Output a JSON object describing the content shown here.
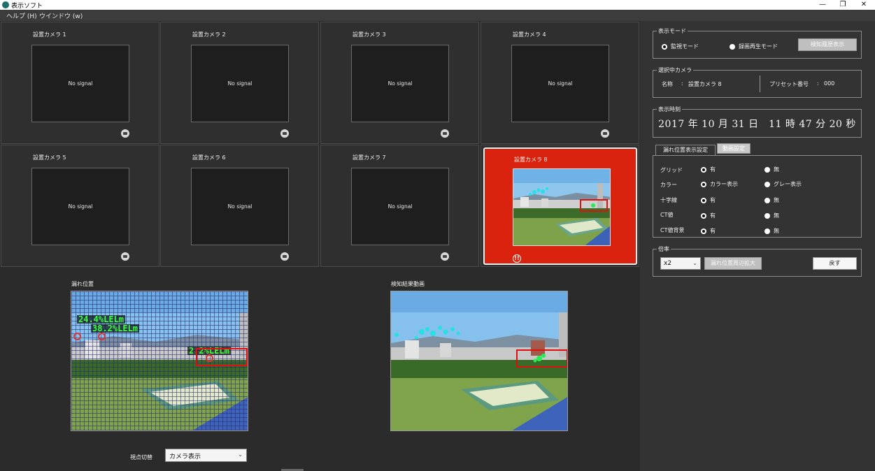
{
  "window": {
    "title": "表示ソフト",
    "controls": {
      "minimize": "—",
      "maximize": "❐",
      "close": "✕"
    }
  },
  "menu": {
    "items": [
      "ヘルプ (H)",
      "ウインドウ (w)"
    ]
  },
  "cameras": [
    {
      "label": "設置カメラ 1",
      "status": "No signal"
    },
    {
      "label": "設置カメラ 2",
      "status": "No signal"
    },
    {
      "label": "設置カメラ 3",
      "status": "No signal"
    },
    {
      "label": "設置カメラ 4",
      "status": "No signal"
    },
    {
      "label": "設置カメラ 5",
      "status": "No signal"
    },
    {
      "label": "設置カメラ 6",
      "status": "No signal"
    },
    {
      "label": "設置カメラ 7",
      "status": "No signal"
    },
    {
      "label": "設置カメラ 8",
      "status": "",
      "alert": true,
      "alert_symbol": "!!"
    }
  ],
  "leak_view": {
    "title": "漏れ位置",
    "readings": [
      "24.4%LELm",
      "38.2%LELm",
      "2.2%LELm"
    ]
  },
  "result_view": {
    "title": "検知結果動画"
  },
  "view_switch": {
    "label": "視点切替",
    "value": "カメラ表示",
    "chevron": "⌄"
  },
  "display_mode": {
    "title": "表示モード",
    "options": [
      {
        "label": "監視モード",
        "selected": true
      },
      {
        "label": "録画再生モード",
        "selected": false
      }
    ],
    "history_button": "検知履歴表示"
  },
  "selected_camera": {
    "title": "選択中カメラ",
    "name_label": "名称",
    "separator": ":",
    "name_value": "設置カメラ 8",
    "preset_label": "プリセット番号",
    "preset_value": "000"
  },
  "display_time": {
    "title": "表示時刻",
    "value": "2017 年 10 月 31 日　11 時 47 分 20 秒"
  },
  "settings_tabs": [
    "漏れ位置表示設定",
    "動画設定"
  ],
  "settings_rows": [
    {
      "label": "グリッド",
      "on": "有",
      "off": "無",
      "on_selected": true
    },
    {
      "label": "カラー",
      "on": "カラー表示",
      "off": "グレー表示",
      "on_selected": true
    },
    {
      "label": "十字線",
      "on": "有",
      "off": "無",
      "on_selected": true
    },
    {
      "label": "CT値",
      "on": "有",
      "off": "無",
      "on_selected": true
    },
    {
      "label": "CT値背景",
      "on": "有",
      "off": "無",
      "on_selected": true
    }
  ],
  "magnification": {
    "title": "倍率",
    "value": "x2",
    "zoom_button": "漏れ位置周辺拡大",
    "back_button": "戻す"
  },
  "colors": {
    "alert_red": "#d9230f",
    "lel_green": "#39ff3a",
    "panel_bg": "#2b2b2b"
  }
}
